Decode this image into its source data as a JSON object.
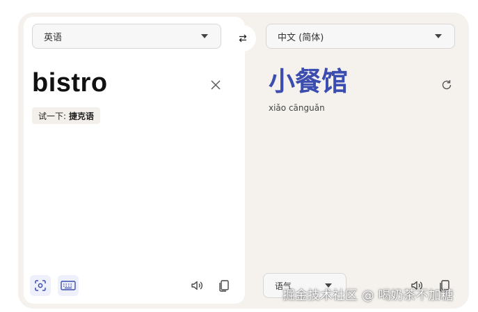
{
  "source": {
    "language": "英语",
    "text": "bistro",
    "try_prefix": "试一下:",
    "try_language": "捷克语"
  },
  "target": {
    "language": "中文 (简体)",
    "text": "小餐馆",
    "romanization": "xiǎo cānguǎn",
    "tone_label": "语气"
  },
  "icons": {
    "swap": "swap-arrows-icon",
    "clear": "close-icon",
    "refresh": "refresh-icon",
    "lens": "camera-lens-icon",
    "keyboard": "keyboard-icon",
    "speak": "speaker-icon",
    "copy": "copy-icon"
  },
  "colors": {
    "accent": "#3b4eb0",
    "panel_bg": "#f5f2ee"
  },
  "watermark": "掘金技术社区 @ 喝奶茶不加糖"
}
